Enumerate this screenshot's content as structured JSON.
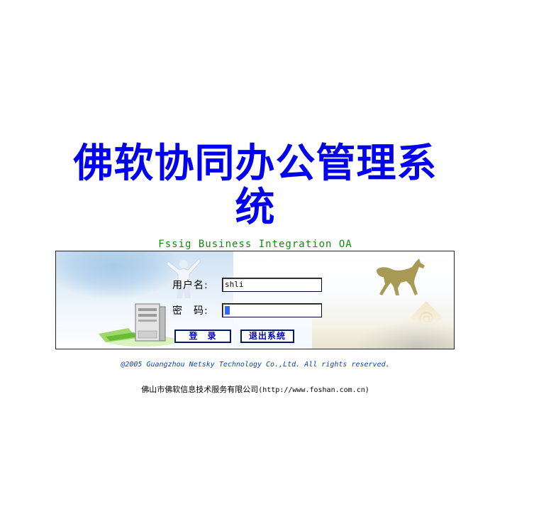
{
  "header": {
    "title": "佛软协同办公管理系统",
    "subtitle": "Fssig Business Integration OA"
  },
  "login": {
    "username_label": "用户名:",
    "username_value": "shli",
    "password_label": "密　码:",
    "password_value": "•",
    "login_button": "登　录",
    "exit_button": "退出系统"
  },
  "footer": {
    "copyright": "@2005 Guangzhou Netsky Technology Co.,Ltd. All rights reserved.",
    "company": "佛山市佛软信息技术服务有限公司",
    "company_url": "(http://www.foshan.com.cn)"
  },
  "colors": {
    "title": "#0000ee",
    "subtitle": "#118811",
    "button_text": "#0000cc",
    "copyright": "#0044cc"
  },
  "icons": [
    "businessman-icon",
    "server-icon",
    "horse-logo-icon",
    "email-at-icon"
  ]
}
